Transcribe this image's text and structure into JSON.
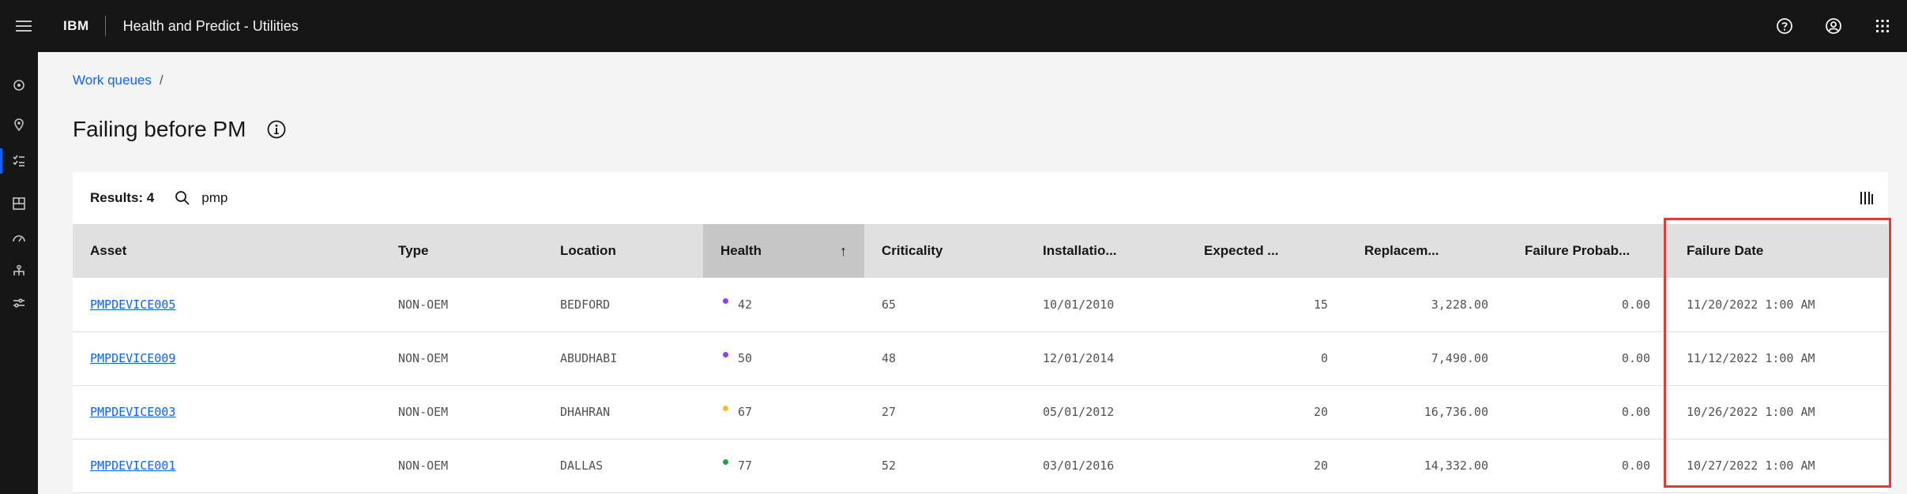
{
  "header": {
    "brand": "IBM",
    "app_title": "Health and Predict - Utilities"
  },
  "breadcrumb": {
    "link": "Work queues",
    "separator": "/"
  },
  "page": {
    "title": "Failing before PM"
  },
  "toolbar": {
    "results_label": "Results: 4",
    "search_value": "pmp"
  },
  "table": {
    "columns": [
      "Asset",
      "Type",
      "Location",
      "Health",
      "Criticality",
      "Installatio...",
      "Expected ...",
      "Replacem...",
      "Failure Probab...",
      "Failure Date"
    ],
    "sort_indicator": "↑",
    "rows": [
      {
        "asset": "PMPDEVICE005",
        "type": "NON-OEM",
        "location": "BEDFORD",
        "health": "42",
        "health_color": "#8a3ffc",
        "criticality": "65",
        "installation": "10/01/2010",
        "expected": "15",
        "replacement": "3,228.00",
        "failure_prob": "0.00",
        "failure_date": "11/20/2022 1:00 AM"
      },
      {
        "asset": "PMPDEVICE009",
        "type": "NON-OEM",
        "location": "ABUDHABI",
        "health": "50",
        "health_color": "#8a3ffc",
        "criticality": "48",
        "installation": "12/01/2014",
        "expected": "0",
        "replacement": "7,490.00",
        "failure_prob": "0.00",
        "failure_date": "11/12/2022 1:00 AM"
      },
      {
        "asset": "PMPDEVICE003",
        "type": "NON-OEM",
        "location": "DHAHRAN",
        "health": "67",
        "health_color": "#f1c21b",
        "criticality": "27",
        "installation": "05/01/2012",
        "expected": "20",
        "replacement": "16,736.00",
        "failure_prob": "0.00",
        "failure_date": "10/26/2022 1:00 AM"
      },
      {
        "asset": "PMPDEVICE001",
        "type": "NON-OEM",
        "location": "DALLAS",
        "health": "77",
        "health_color": "#24a148",
        "criticality": "52",
        "installation": "03/01/2016",
        "expected": "20",
        "replacement": "14,332.00",
        "failure_prob": "0.00",
        "failure_date": "10/27/2022 1:00 AM"
      }
    ]
  },
  "colors": {
    "header_bg": "#161616",
    "link": "#0f62fe",
    "highlight_border": "#e03b3b"
  }
}
